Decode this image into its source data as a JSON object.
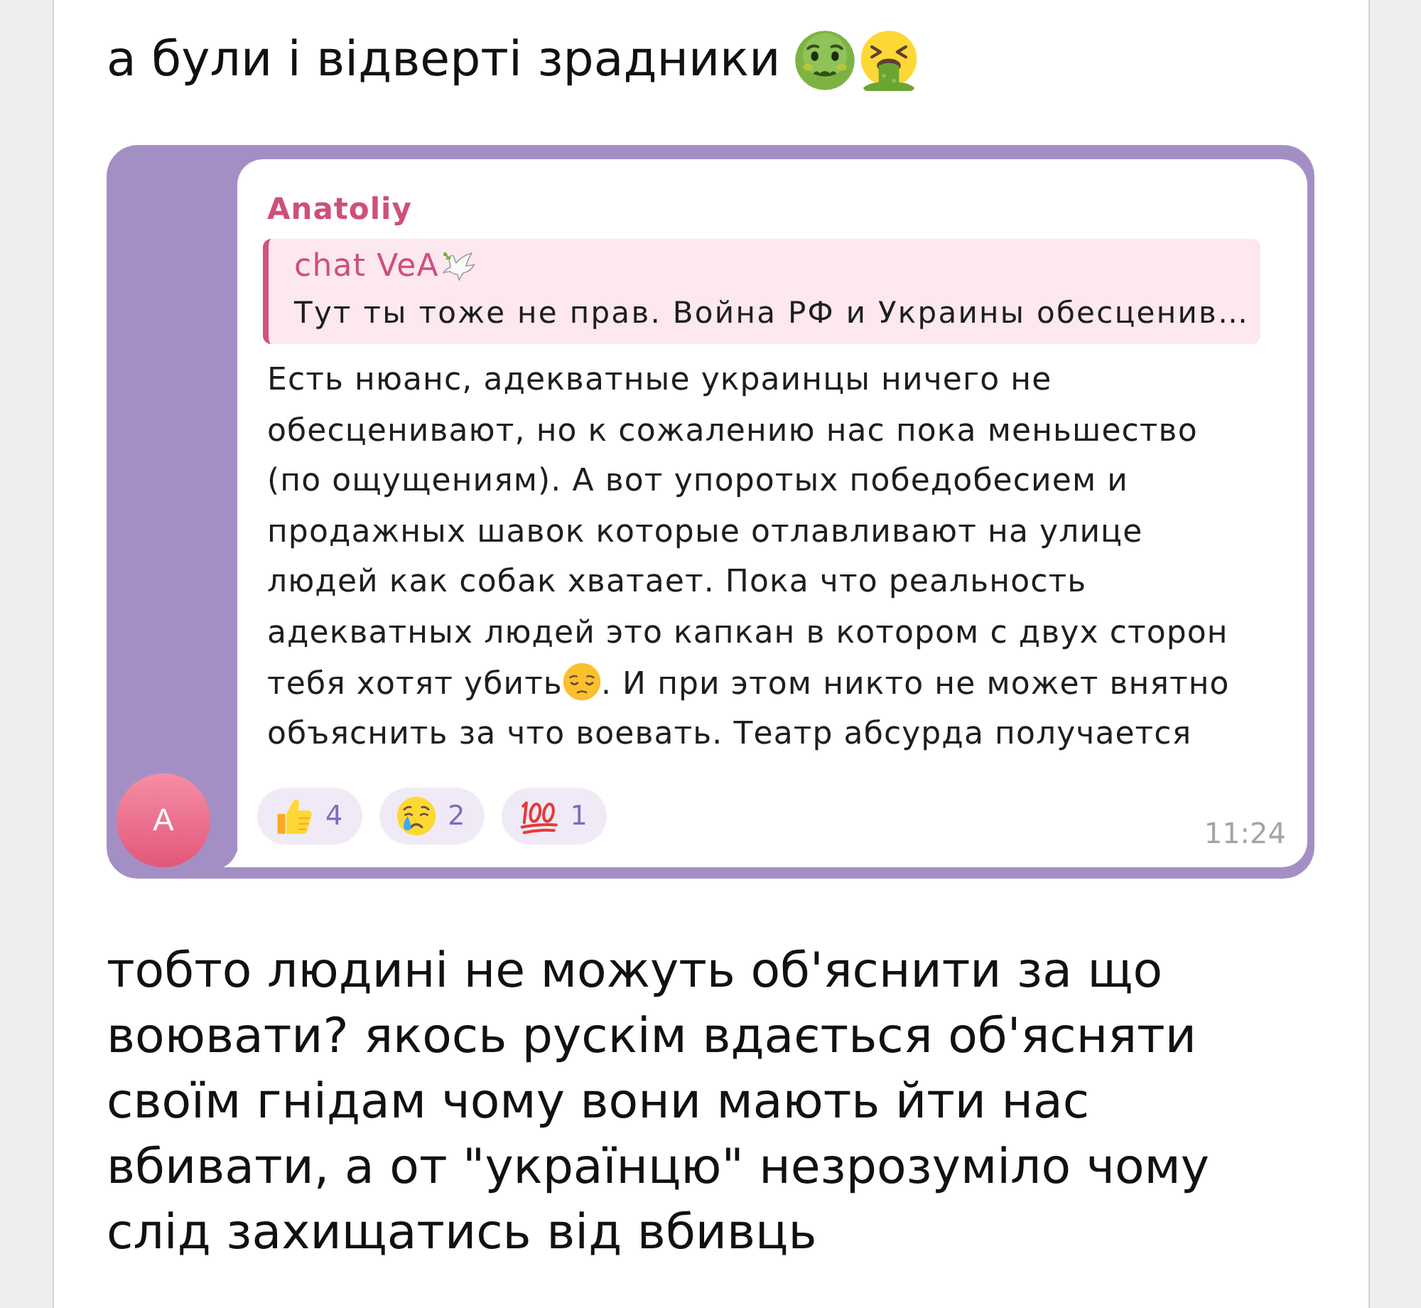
{
  "post_top": {
    "text": "а були і відверті зрадники"
  },
  "screenshot": {
    "avatar_letter": "A",
    "sender": "Anatoliy",
    "reply": {
      "author": "chat VeA",
      "text": "Тут ты тоже не прав. Война РФ и Украины обесценив…"
    },
    "text_parts": [
      "Есть нюанс, адекватные украинцы ничего не обесценивают, но к сожалению нас пока меньшество (по ощущениям). А вот упоротых победобесием и продажных шавок которые отлавливают на улице людей как собак хватает. Пока что реальность адекватных людей это капкан в котором с двух сторон тебя хотят убить",
      ". И при этом никто не может внятно объяснить за что воевать. Театр абсурда получается"
    ],
    "reactions": [
      {
        "kind": "thumbs_up",
        "count": "4"
      },
      {
        "kind": "crying",
        "count": "2"
      },
      {
        "kind": "hundred",
        "count": "1"
      }
    ],
    "time": "11:24"
  },
  "post_bottom": {
    "text": "тобто людині не можуть об'яснити за що воювати? якось рускім вдається об'ясняти своїм гнідам чому вони мають йти нас вбивати, а от \"українцю\" незрозуміло чому слід захищатись від вбивць"
  }
}
